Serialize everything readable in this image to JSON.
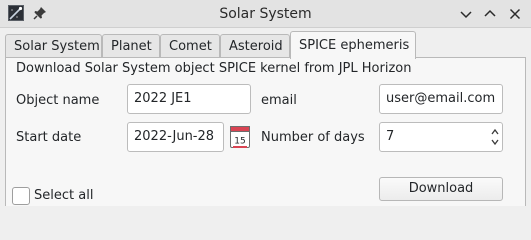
{
  "window": {
    "title": "Solar System",
    "controls": [
      "chevron-down-icon",
      "chevron-up-icon",
      "close-icon"
    ]
  },
  "tabs": [
    {
      "label": "Solar System",
      "active": false
    },
    {
      "label": "Planet",
      "active": false
    },
    {
      "label": "Comet",
      "active": false
    },
    {
      "label": "Asteroid",
      "active": false
    },
    {
      "label": "SPICE ephemeris",
      "active": true
    }
  ],
  "form": {
    "heading": "Download Solar System object SPICE kernel from JPL Horizon",
    "object_name_label": "Object name",
    "object_name_value": "2022 JE1",
    "email_label": "email",
    "email_value": "user@email.com",
    "start_date_label": "Start date",
    "start_date_value": "2022-Jun-28",
    "calendar_day": "15",
    "num_days_label": "Number of days",
    "num_days_value": "7",
    "select_all_label": "Select all",
    "select_all_checked": false,
    "download_label": "Download"
  },
  "colors": {
    "accent": "#3daee9",
    "calendar_red": "#da4453"
  }
}
